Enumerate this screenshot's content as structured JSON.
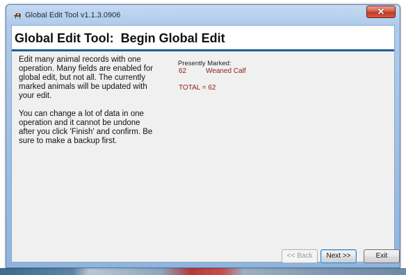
{
  "window": {
    "title": "Global Edit Tool v1.1.3.0906",
    "close_label": "✕"
  },
  "header": {
    "title": "Global Edit Tool:  Begin Global Edit"
  },
  "description": {
    "paragraph1": "Edit many animal records with one operation.  Many fields are enabled for global edit, but not all.  The currently marked animals will be updated with your edit.",
    "paragraph2": "You can change a lot of data in one operation and it cannot be undone after you click 'Finish' and confirm.  Be sure to make a backup first."
  },
  "marked": {
    "label": "Presently Marked:",
    "items": [
      {
        "count": "62",
        "description": "Weaned Calf"
      }
    ],
    "total": "TOTAL = 62"
  },
  "buttons": {
    "back": "<< Back",
    "next": "Next >>",
    "exit": "Exit"
  },
  "colors": {
    "accent_rule": "#1f5c99",
    "marked_text": "#8b1a1a",
    "close_button": "#c0392b"
  },
  "icons": {
    "app": "cow-icon",
    "close": "close-icon"
  }
}
